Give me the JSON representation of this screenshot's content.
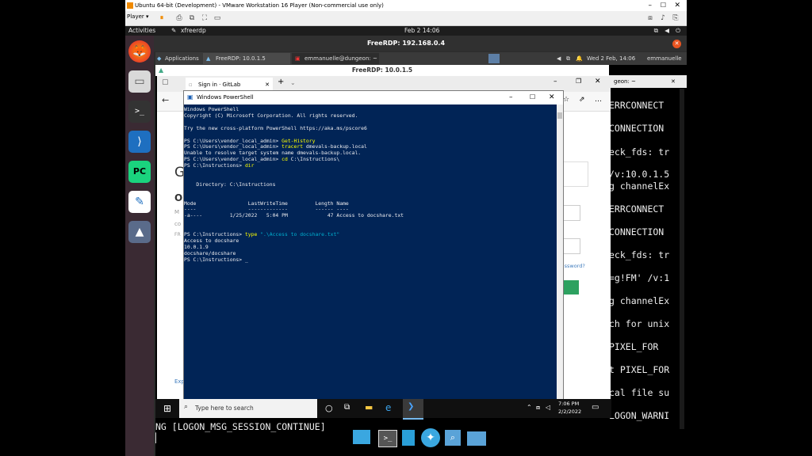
{
  "vmware": {
    "title": "Ubuntu 64-bit (Development) - VMware Workstation 16 Player (Non-commercial use only)",
    "player_label": "Player ▾"
  },
  "ubuntu": {
    "activities": "Activities",
    "app_name": "xfreerdp",
    "clock": "Feb 2  14:06",
    "window_title": "FreeRDP: 192.168.0.4"
  },
  "xfce": {
    "applications": "Applications",
    "task1": "FreeRDP: 10.0.1.5",
    "task2": "emmanuelle@dungeon: ~",
    "clock": "Wed  2 Feb, 14:06",
    "user": "emmanuelle"
  },
  "freerdp_inner_title": "FreeRDP: 10.0.1.5",
  "terminal_side_title": "geon: ~",
  "terminal_lines": [
    "ERRCONNECT",
    "CONNECTION",
    "eck_fds: tr",
    "/v:10.0.1.5",
    "g channelEx",
    "ERRCONNECT",
    "CONNECTION",
    "eck_fds: tr",
    "=g!FM' /v:1",
    "g channelEx",
    "ch for unix",
    "PIXEL_FOR",
    "t PIXEL_FOR",
    "cal file su",
    "LOGON_WARNI"
  ],
  "terminal_bottom": "NG [LOGON_MSG_SESSION_CONTINUE]",
  "edge": {
    "tab_title": "Sign in · GitLab",
    "side_text_1": "Password?",
    "side_letter": "G",
    "side_letter2": "O",
    "side_small1": "M",
    "side_small2": "co",
    "side_small3": "FR",
    "exp": "Exp"
  },
  "powershell": {
    "title": "Windows PowerShell",
    "lines": [
      {
        "parts": [
          {
            "t": "Windows PowerShell",
            "c": ""
          }
        ]
      },
      {
        "parts": [
          {
            "t": "Copyright (C) Microsoft Corporation. All rights reserved.",
            "c": ""
          }
        ]
      },
      {
        "parts": [
          {
            "t": "",
            "c": ""
          }
        ]
      },
      {
        "parts": [
          {
            "t": "Try the new cross-platform PowerShell https://aka.ms/pscore6",
            "c": ""
          }
        ]
      },
      {
        "parts": [
          {
            "t": "",
            "c": ""
          }
        ]
      },
      {
        "parts": [
          {
            "t": "PS C:\\Users\\vendor_local_admin> ",
            "c": ""
          },
          {
            "t": "Get-History",
            "c": "y"
          }
        ]
      },
      {
        "parts": [
          {
            "t": "PS C:\\Users\\vendor_local_admin> ",
            "c": ""
          },
          {
            "t": "tracert",
            "c": "y"
          },
          {
            "t": " dmevals-backup.local",
            "c": ""
          }
        ]
      },
      {
        "parts": [
          {
            "t": "Unable to resolve target system name dmevals-backup.local.",
            "c": ""
          }
        ]
      },
      {
        "parts": [
          {
            "t": "PS C:\\Users\\vendor_local_admin> ",
            "c": ""
          },
          {
            "t": "cd",
            "c": "y"
          },
          {
            "t": " C:\\Instructions\\",
            "c": ""
          }
        ]
      },
      {
        "parts": [
          {
            "t": "PS C:\\Instructions> ",
            "c": ""
          },
          {
            "t": "dir",
            "c": "y"
          }
        ]
      },
      {
        "parts": [
          {
            "t": "",
            "c": ""
          }
        ]
      },
      {
        "parts": [
          {
            "t": "",
            "c": ""
          }
        ]
      },
      {
        "parts": [
          {
            "t": "    Directory: C:\\Instructions",
            "c": ""
          }
        ]
      },
      {
        "parts": [
          {
            "t": "",
            "c": ""
          }
        ]
      },
      {
        "parts": [
          {
            "t": "",
            "c": ""
          }
        ]
      },
      {
        "parts": [
          {
            "t": "Mode                 LastWriteTime         Length Name",
            "c": ""
          }
        ]
      },
      {
        "parts": [
          {
            "t": "----                 -------------         ------ ----",
            "c": ""
          }
        ]
      },
      {
        "parts": [
          {
            "t": "-a----         1/25/2022   5:04 PM             47 Access to docshare.txt",
            "c": ""
          }
        ]
      },
      {
        "parts": [
          {
            "t": "",
            "c": ""
          }
        ]
      },
      {
        "parts": [
          {
            "t": "",
            "c": ""
          }
        ]
      },
      {
        "parts": [
          {
            "t": "PS C:\\Instructions> ",
            "c": ""
          },
          {
            "t": "type",
            "c": "y"
          },
          {
            "t": " \".\\Access to docshare.txt\"",
            "c": "s"
          }
        ]
      },
      {
        "parts": [
          {
            "t": "Access to docshare",
            "c": ""
          }
        ]
      },
      {
        "parts": [
          {
            "t": "10.0.1.9",
            "c": ""
          }
        ]
      },
      {
        "parts": [
          {
            "t": "docshare/docshare",
            "c": ""
          }
        ]
      },
      {
        "parts": [
          {
            "t": "PS C:\\Instructions> ",
            "c": ""
          },
          {
            "t": "_",
            "c": ""
          }
        ]
      }
    ]
  },
  "taskbar": {
    "search_placeholder": "Type here to search",
    "time": "7:06 PM",
    "date": "2/2/2022"
  }
}
